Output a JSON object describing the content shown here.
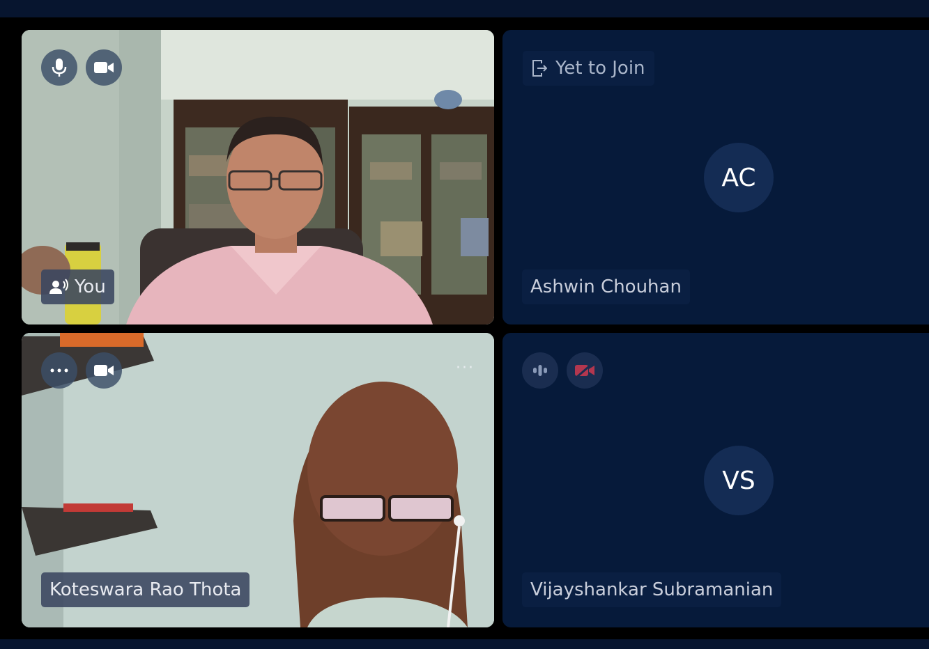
{
  "tiles": {
    "self": {
      "name": "You",
      "controls": [
        "microphone-icon",
        "video-camera-icon"
      ],
      "speaker_icon": "speaking-user-icon"
    },
    "ashwin": {
      "status": "Yet to Join",
      "status_icon": "exit-door-icon",
      "initials": "AC",
      "name": "Ashwin Chouhan"
    },
    "koteswara": {
      "name": "Koteswara Rao Thota",
      "controls": [
        "more-options-icon",
        "video-camera-icon"
      ],
      "menu": "···"
    },
    "vijay": {
      "initials": "VS",
      "name": "Vijayshankar Subramanian",
      "controls": [
        "audio-level-icon",
        "video-off-icon"
      ],
      "video_off_color": "#b3374f"
    }
  },
  "colors": {
    "background": "#000000",
    "panel": "#061a3a",
    "topbar": "#07152f",
    "avatar_bg": "#142c54"
  }
}
